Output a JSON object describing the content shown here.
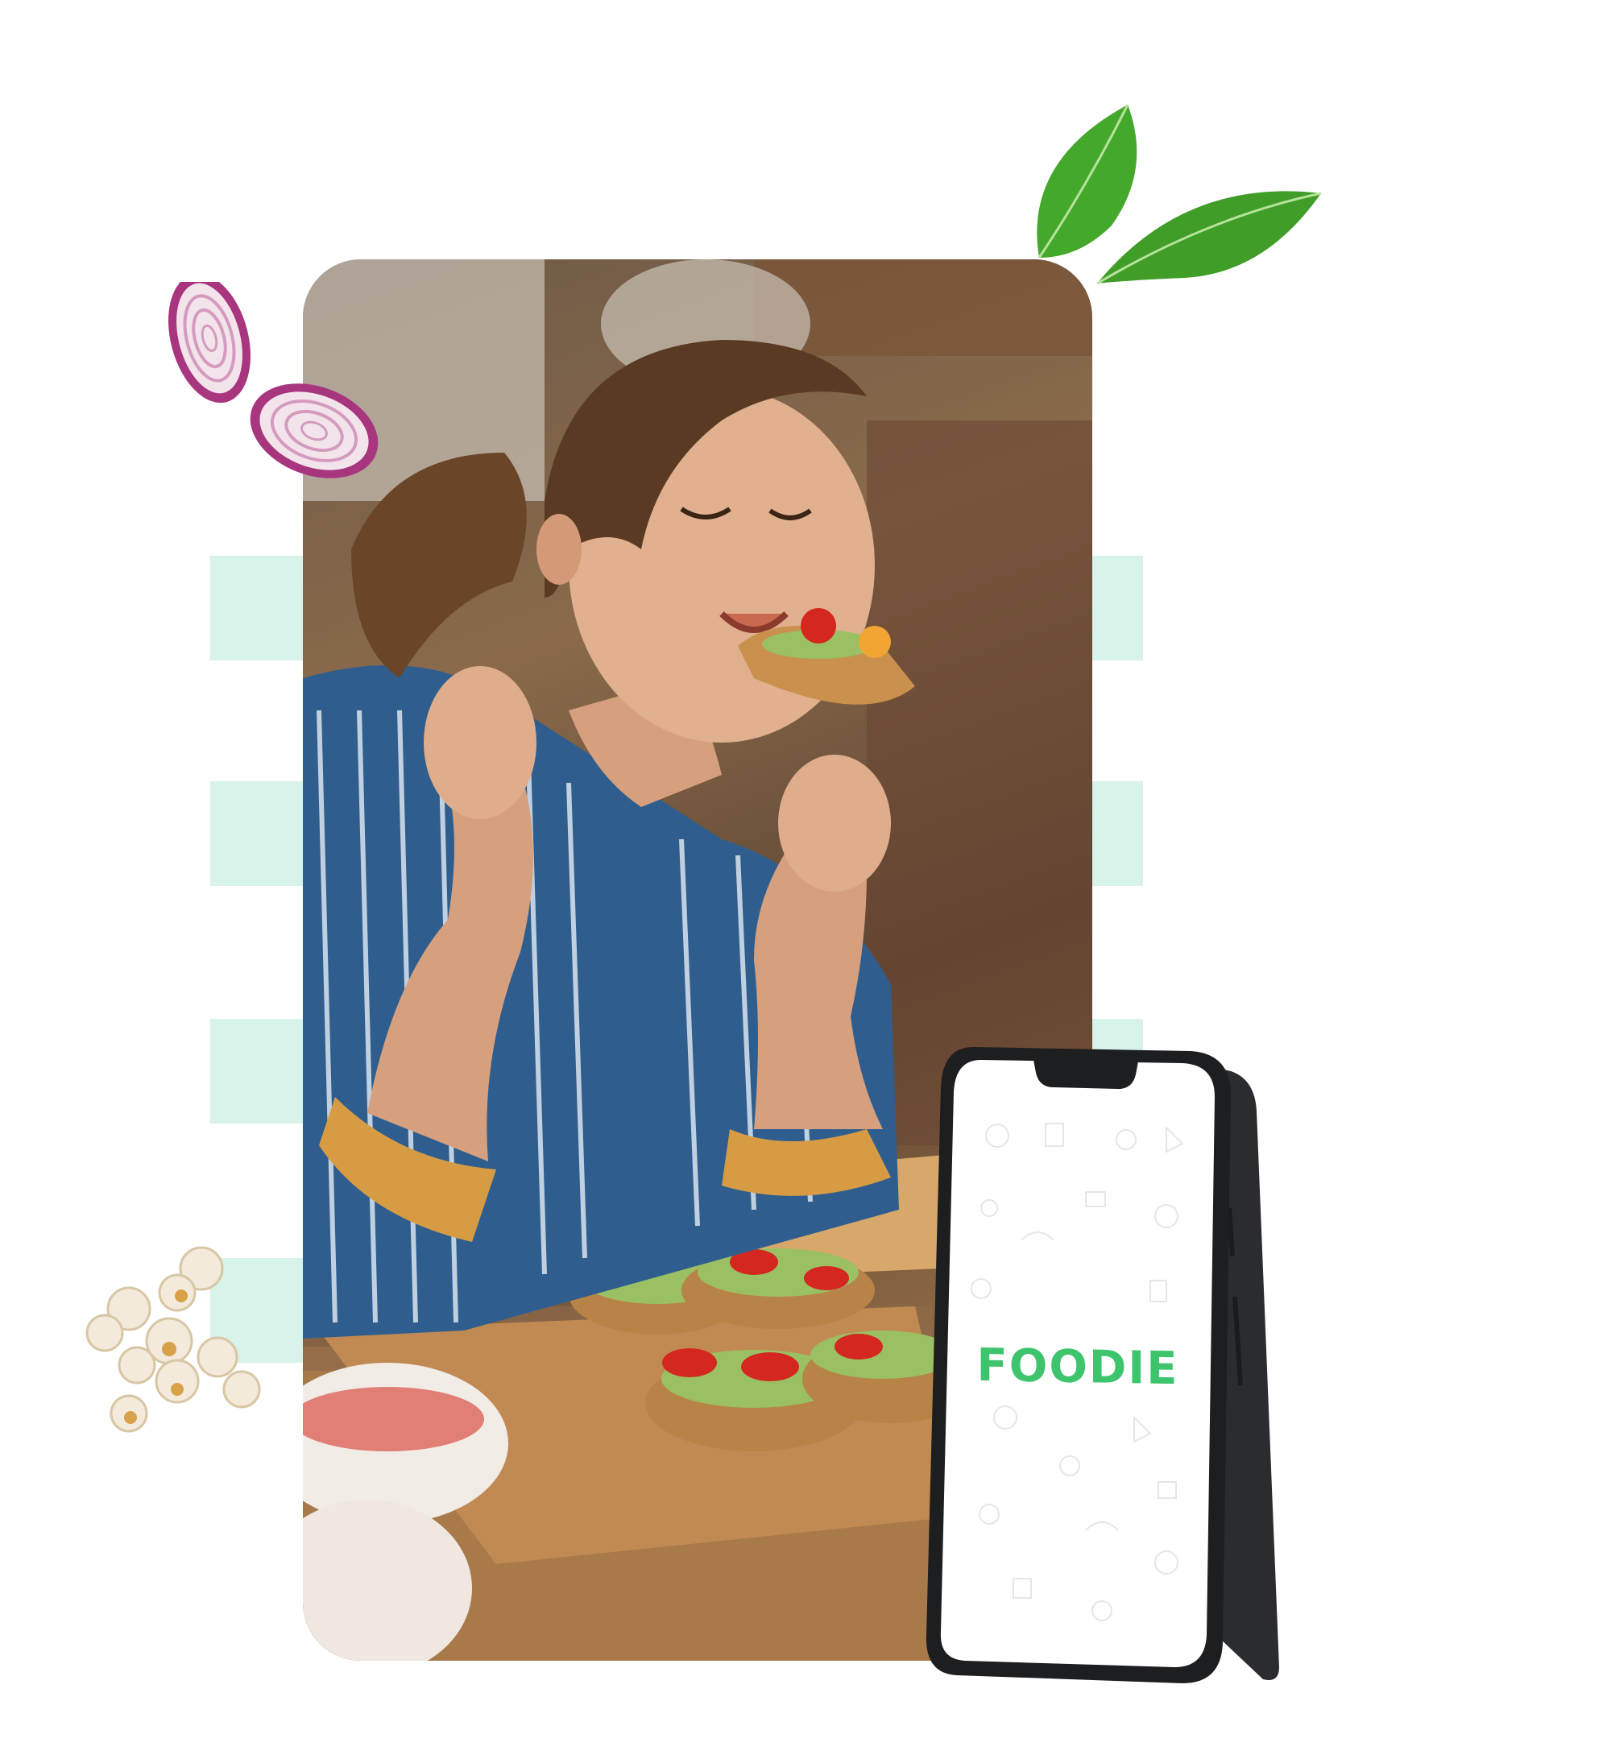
{
  "brand": {
    "app_name": "FOODIE",
    "accent_color": "#3ec46d",
    "stripe_color": "#d7f3ea"
  },
  "hero": {
    "photo_subject": "woman-eating-bruschetta-in-kitchen",
    "decor_icons": [
      "red-onion-slice-icon",
      "basil-leaf-icon",
      "popcorn-icon"
    ]
  },
  "device": {
    "type": "smartphone",
    "screen_background": "#ffffff",
    "screen_pattern": "food-doodle-pattern"
  }
}
